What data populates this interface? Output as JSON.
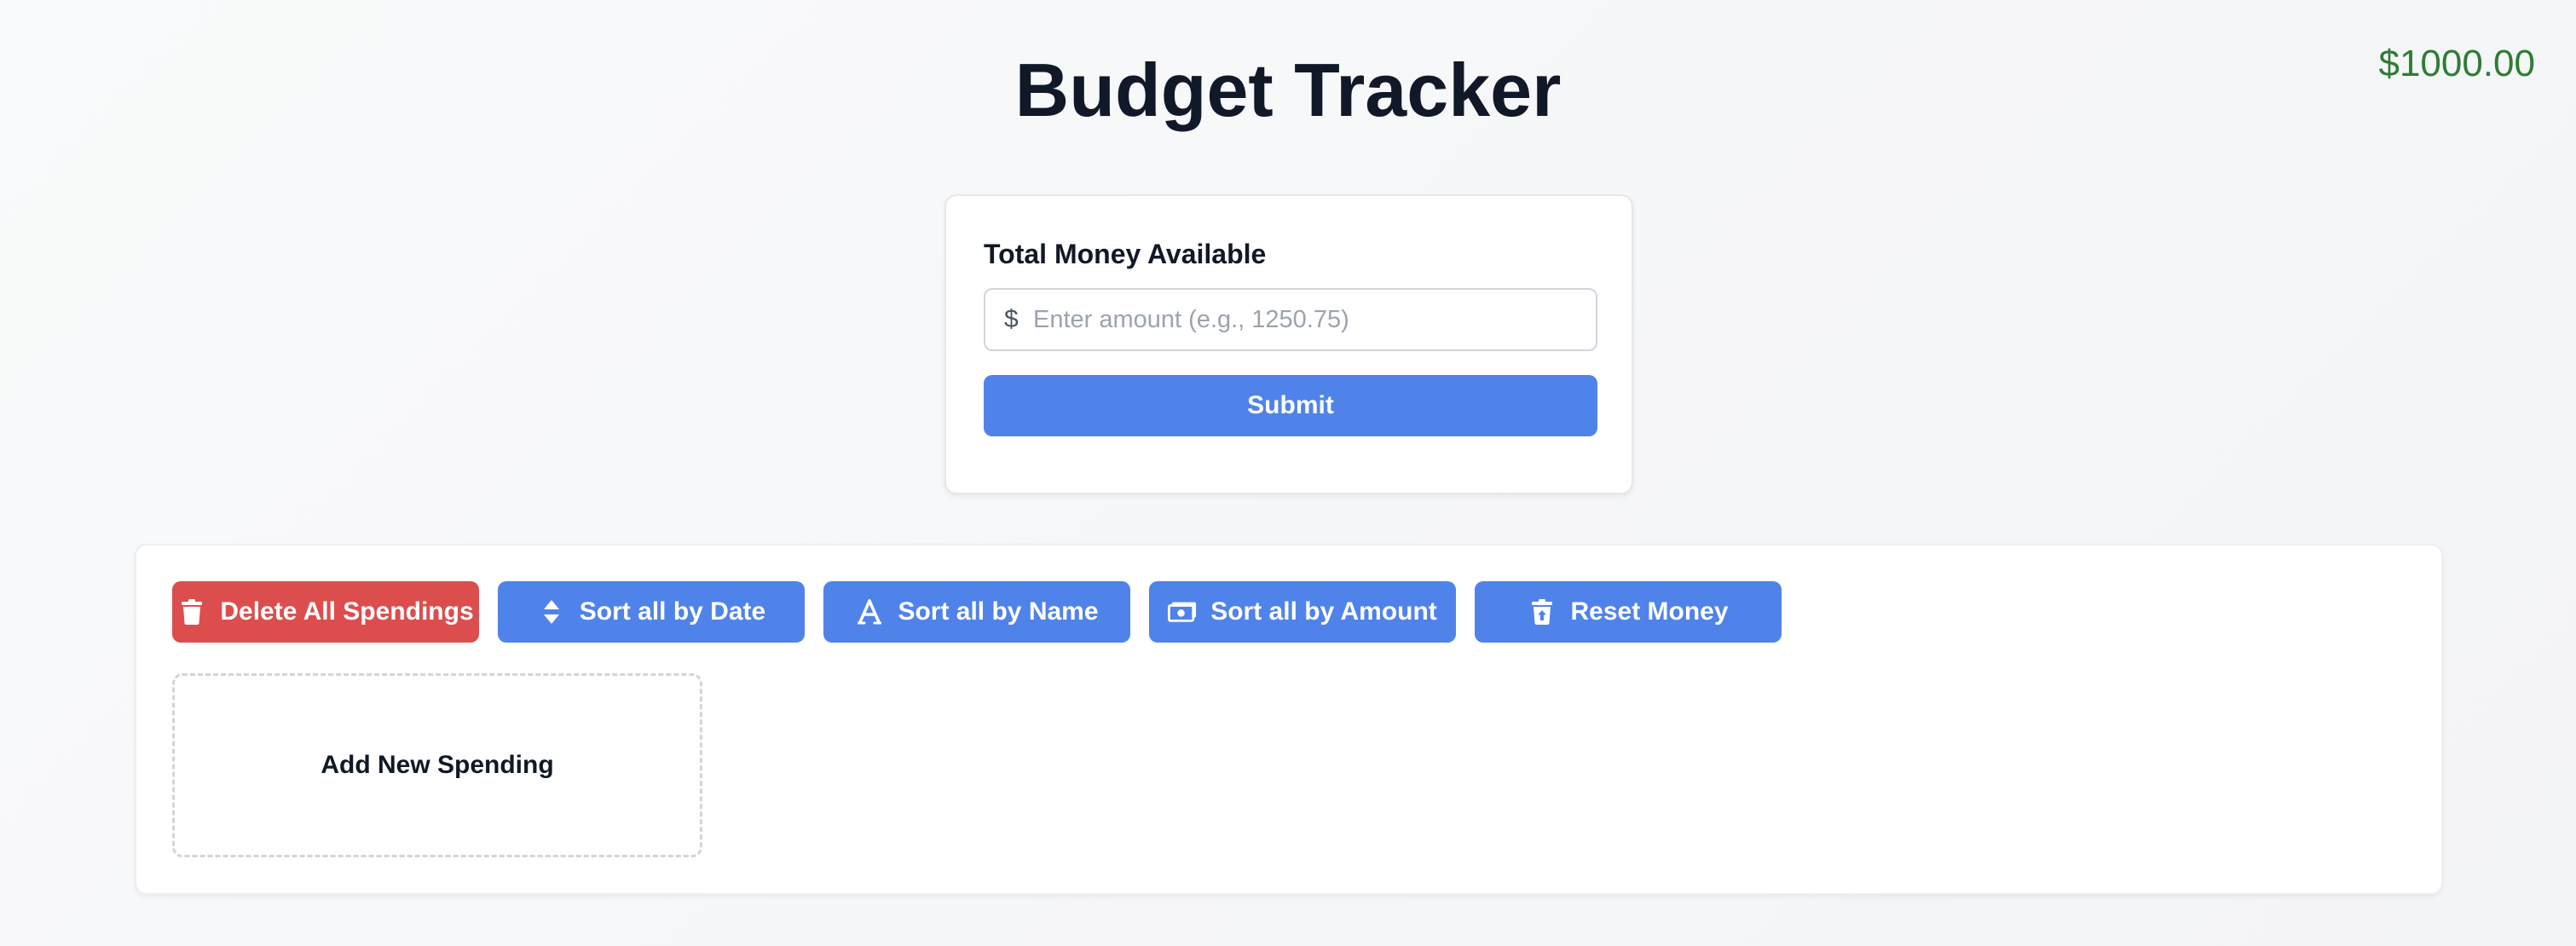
{
  "header": {
    "title": "Budget Tracker",
    "balance": "$1000.00"
  },
  "money_form": {
    "label": "Total Money Available",
    "currency_symbol": "$",
    "input_value": "",
    "input_placeholder": "Enter amount (e.g., 1250.75)",
    "submit_label": "Submit"
  },
  "toolbar": {
    "buttons": [
      {
        "label": "Delete All Spendings",
        "icon": "trash-icon",
        "color": "#dc4e4e"
      },
      {
        "label": "Sort all by Date",
        "icon": "sort-icon",
        "color": "#4f83ea"
      },
      {
        "label": "Sort all by Name",
        "icon": "font-icon",
        "color": "#4f83ea"
      },
      {
        "label": "Sort all by Amount",
        "icon": "money-bill-icon",
        "color": "#4f83ea"
      },
      {
        "label": "Reset Money",
        "icon": "trash-restore-icon",
        "color": "#4f83ea"
      }
    ]
  },
  "spendings": {
    "add_new_label": "Add New Spending",
    "items": []
  },
  "colors": {
    "primary": "#4f83ea",
    "danger": "#dc4e4e",
    "balance": "#2e7d32",
    "title": "#111827"
  }
}
